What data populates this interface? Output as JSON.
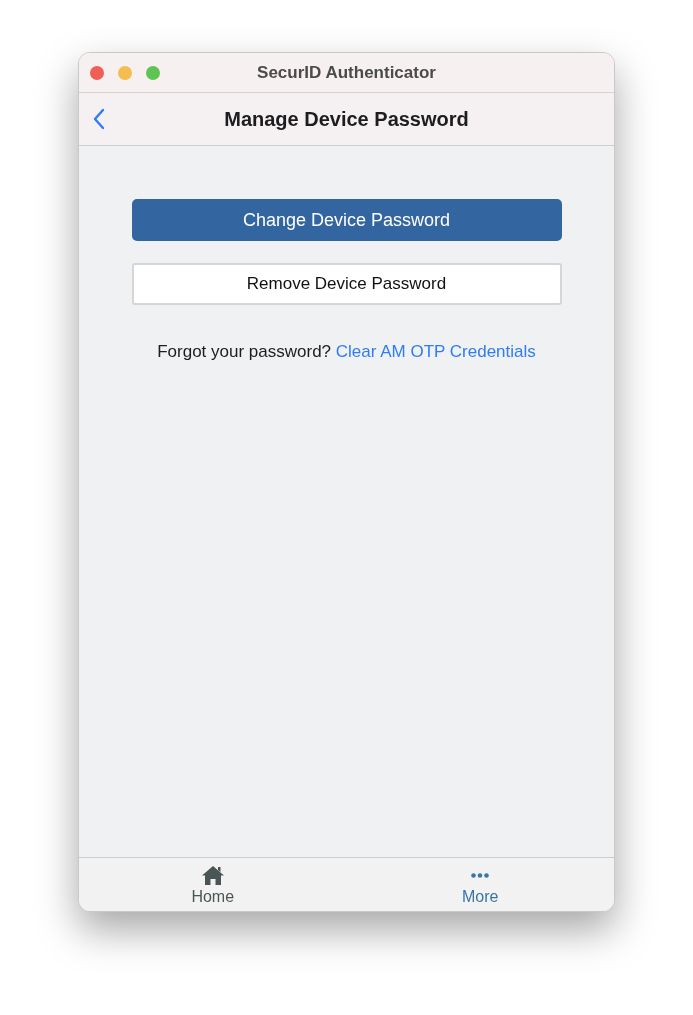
{
  "window": {
    "title": "SecurID Authenticator"
  },
  "nav_bar": {
    "title": "Manage Device Password"
  },
  "buttons": [
    {
      "label": "Change Device Password",
      "kind": "primary"
    },
    {
      "label": "Remove Device Password",
      "kind": "secondary"
    }
  ],
  "help": {
    "text": "Forgot your password?",
    "link": "Clear AM OTP Credentials"
  },
  "tab_bar": [
    {
      "label": "Home",
      "kind": "home",
      "selected": false
    },
    {
      "label": "More",
      "kind": "more",
      "selected": true
    }
  ]
}
